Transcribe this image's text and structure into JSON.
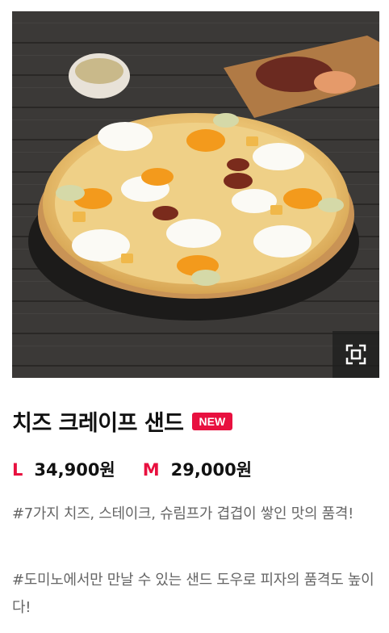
{
  "product": {
    "title": "치즈 크레이프 샌드",
    "badge": "NEW",
    "prices": [
      {
        "size": "L",
        "amount": "34,900원"
      },
      {
        "size": "M",
        "amount": "29,000원"
      }
    ],
    "descriptions": [
      "#7가지 치즈, 스테이크, 슈림프가 겹겹이 쌓인 맛의 품격!",
      "#도미노에서만 만날 수 있는 샌드 도우로 피자의 품격도 높이다!"
    ]
  },
  "image": {
    "subject": "pizza-photo",
    "zoom_icon": "expand-icon"
  },
  "colors": {
    "accent": "#e8103f",
    "text": "#111111",
    "muted": "#666666"
  }
}
